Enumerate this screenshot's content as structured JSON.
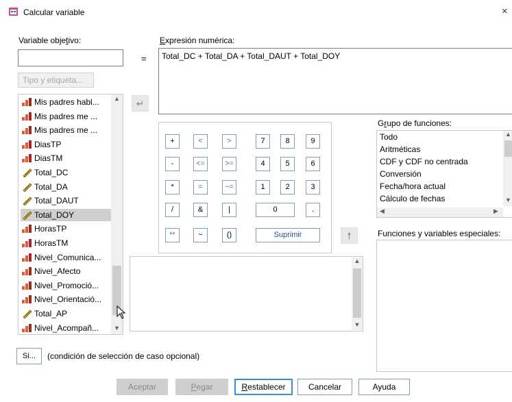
{
  "window": {
    "title": "Calcular variable",
    "close_glyph": "×"
  },
  "target": {
    "label_pre": "Variable obje",
    "label_u": "t",
    "label_post": "ivo:",
    "value": "",
    "equals": "=",
    "type_button": "Tipo y etiqueta..."
  },
  "expression": {
    "label_u": "E",
    "label_post": "xpresión numérica:",
    "value": "Total_DC + Total_DA + Total_DAUT + Total_DOY"
  },
  "variables": [
    {
      "name": "Mis padres habl...",
      "type": "nominal"
    },
    {
      "name": "Mis padres me ...",
      "type": "nominal"
    },
    {
      "name": "Mis padres me ...",
      "type": "nominal"
    },
    {
      "name": "DiasTP",
      "type": "nominal"
    },
    {
      "name": "DiasTM",
      "type": "nominal"
    },
    {
      "name": "Total_DC",
      "type": "scale"
    },
    {
      "name": "Total_DA",
      "type": "scale"
    },
    {
      "name": "Total_DAUT",
      "type": "scale"
    },
    {
      "name": "Total_DOY",
      "type": "scale",
      "selected": true
    },
    {
      "name": "HorasTP",
      "type": "nominal"
    },
    {
      "name": "HorasTM",
      "type": "nominal"
    },
    {
      "name": "Nivel_Comunica...",
      "type": "nominal"
    },
    {
      "name": "Nivel_Afecto",
      "type": "nominal"
    },
    {
      "name": "Nivel_Promoció...",
      "type": "nominal"
    },
    {
      "name": "Nivel_Orientació...",
      "type": "nominal"
    },
    {
      "name": "Total_AP",
      "type": "scale"
    },
    {
      "name": "Nivel_Acompañ...",
      "type": "nominal"
    }
  ],
  "keypad": {
    "plus": "+",
    "lt": "<",
    "gt": ">",
    "d7": "7",
    "d8": "8",
    "d9": "9",
    "minus": "-",
    "le": "<=",
    "ge": ">=",
    "d4": "4",
    "d5": "5",
    "d6": "6",
    "mult": "*",
    "eq": "=",
    "ne": "~=",
    "d1": "1",
    "d2": "2",
    "d3": "3",
    "div": "/",
    "and": "&",
    "or": "|",
    "d0": "0",
    "dot": ".",
    "pow": "**",
    "not": "~",
    "parens": "()",
    "delete": "Suprimir"
  },
  "function_groups": {
    "label_pre": "G",
    "label_u": "r",
    "label_post": "upo de funciones:",
    "items": [
      "Todo",
      "Aritméticas",
      "CDF y CDF no centrada",
      "Conversión",
      "Fecha/hora actual",
      "Cálculo de fechas"
    ]
  },
  "special_functions": {
    "label": "Funciones y variables especiales:"
  },
  "condition": {
    "button": "Si...",
    "text": "(condición de selección de caso opcional)"
  },
  "buttons": {
    "accept": "Aceptar",
    "paste_u": "P",
    "paste_post": "egar",
    "reset_u": "R",
    "reset_post": "establecer",
    "cancel": "Cancelar",
    "help": "Ayuda"
  },
  "colors": {
    "nominal_icon": "#e05a3c",
    "nominal_icon_2": "#a22a1a",
    "scale_icon": "#c9a227",
    "default_button_border": "#3a8ed6"
  }
}
